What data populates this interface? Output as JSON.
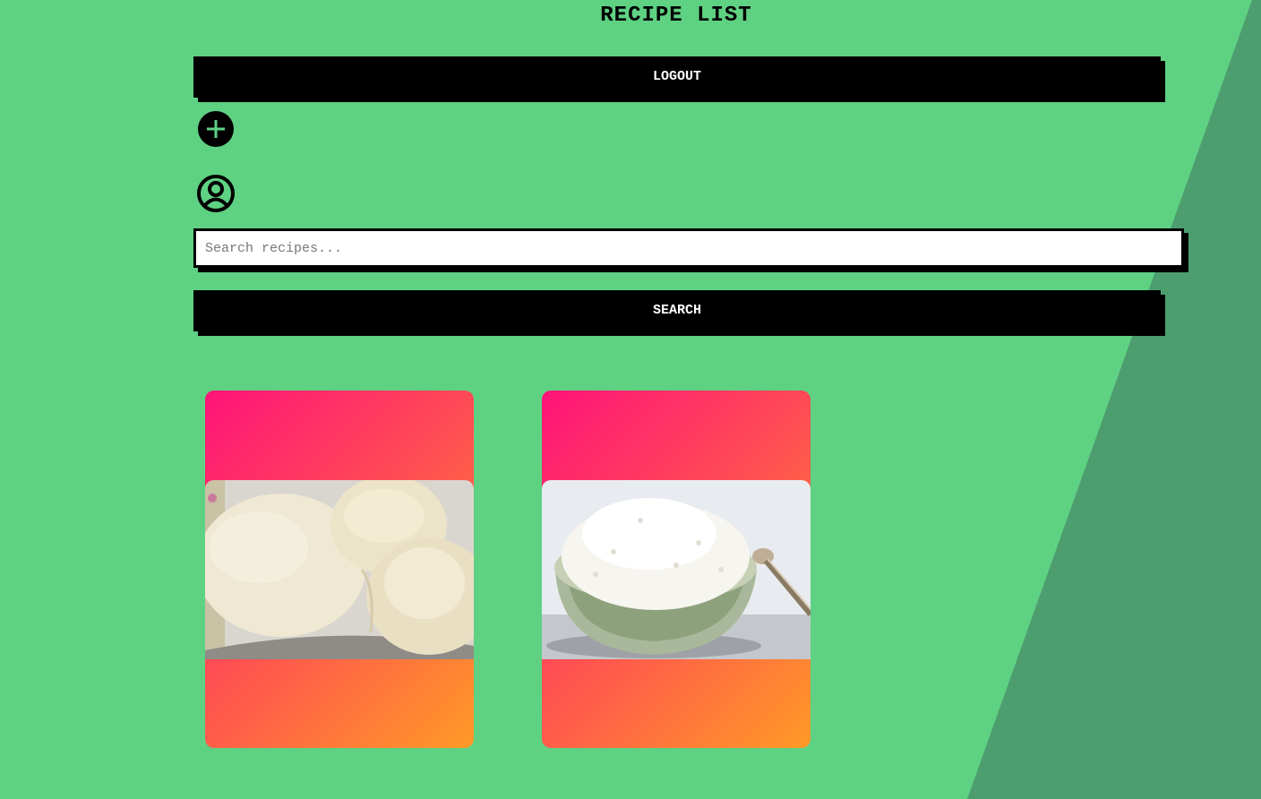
{
  "page": {
    "title": "RECIPE LIST",
    "background_color": "#5fd183",
    "shape_color": "#4d9e6f"
  },
  "header": {
    "logout_label": "LOGOUT"
  },
  "icons": {
    "add": "add-circle-icon",
    "profile": "user-circle-icon"
  },
  "search": {
    "placeholder": "Search recipes...",
    "value": "",
    "button_label": "SEARCH"
  },
  "recipes": [
    {
      "image_name": "idli-steamed-rice-cakes-photo"
    },
    {
      "image_name": "bowl-of-white-rice-photo"
    }
  ],
  "card_gradient": [
    "#ff1379",
    "#ff5350",
    "#ff9a26"
  ]
}
